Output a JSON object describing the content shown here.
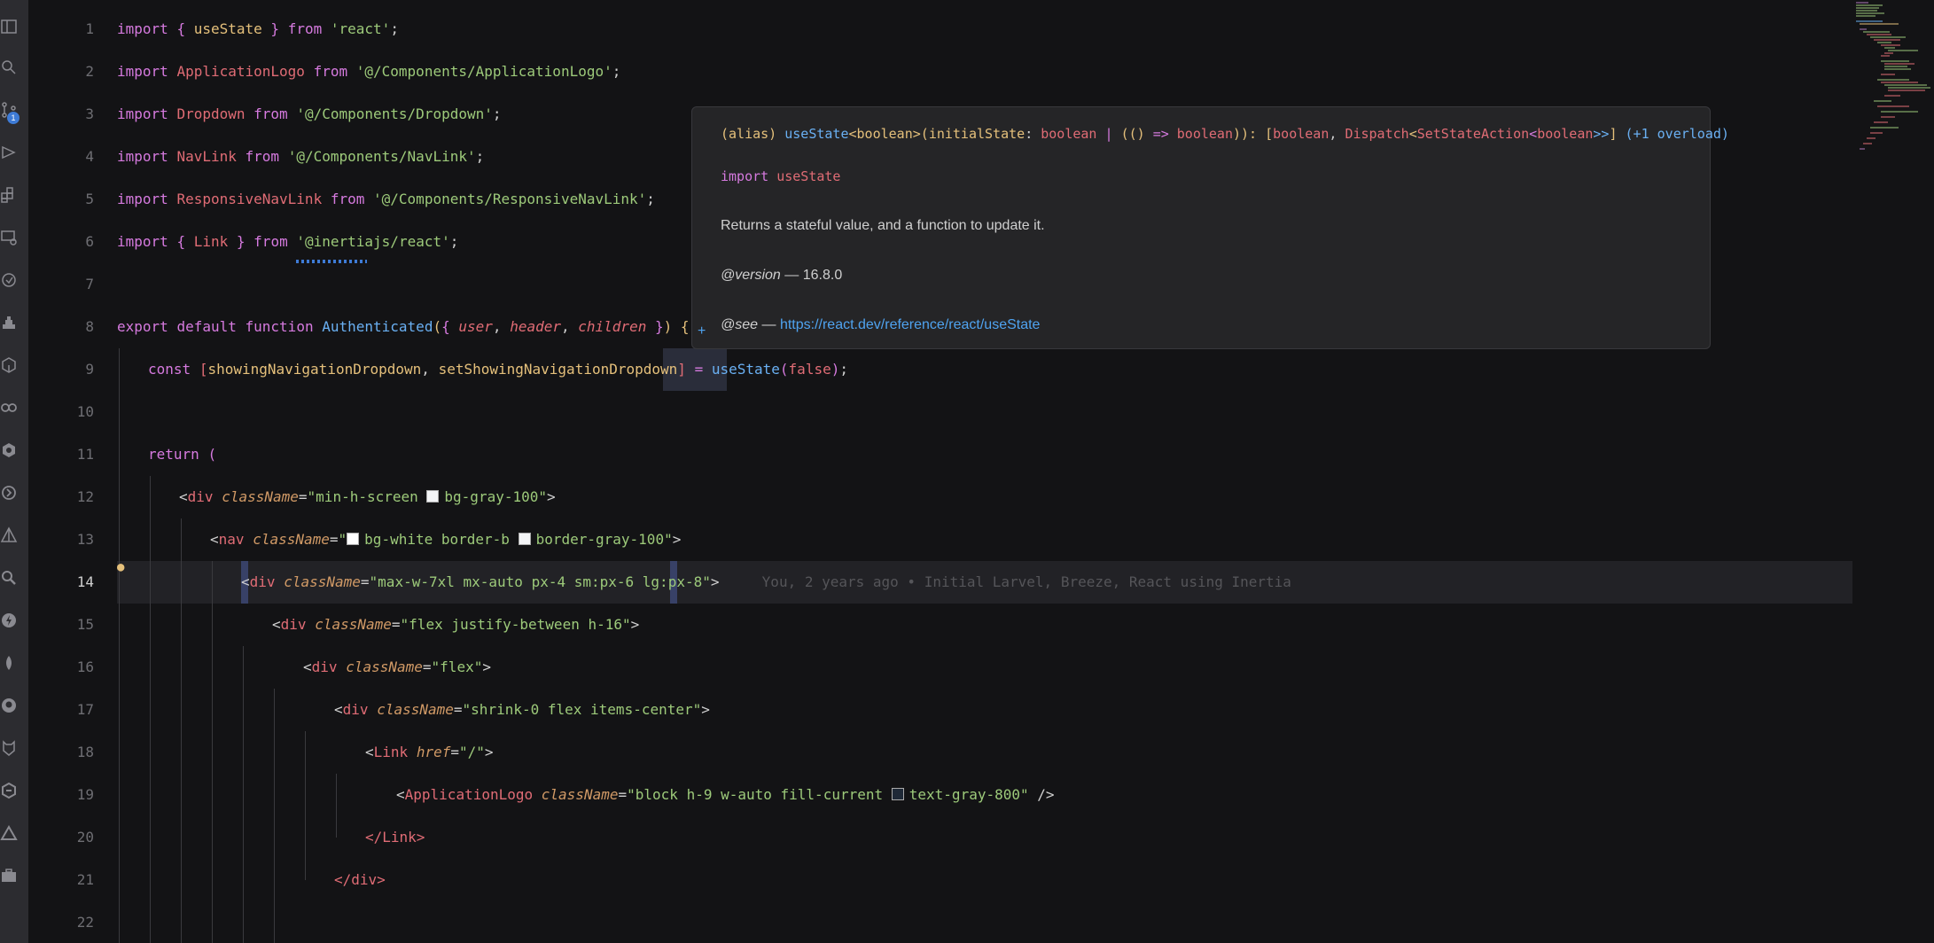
{
  "activity_bar": {
    "badge_count": "1",
    "icons": [
      "sidebar-icon",
      "search-icon",
      "source-control-icon",
      "run-debug-icon",
      "extensions-icon",
      "remote-explorer-icon",
      "docker-icon",
      "testing-icon",
      "database-icon",
      "containers-icon",
      "live-share-icon",
      "settings-sync-icon",
      "git-graph-icon",
      "azure-icon",
      "search-2-icon",
      "thunder-client-icon",
      "mongodb-icon",
      "github-icon",
      "gitlens-icon",
      "gitkraken-icon",
      "deploy-icon",
      "toolbox-icon"
    ]
  },
  "editor": {
    "lines": [
      {
        "n": "1"
      },
      {
        "n": "2"
      },
      {
        "n": "3"
      },
      {
        "n": "4"
      },
      {
        "n": "5"
      },
      {
        "n": "6"
      },
      {
        "n": "7"
      },
      {
        "n": "8"
      },
      {
        "n": "9"
      },
      {
        "n": "10"
      },
      {
        "n": "11"
      },
      {
        "n": "12"
      },
      {
        "n": "13"
      },
      {
        "n": "14"
      },
      {
        "n": "15"
      },
      {
        "n": "16"
      },
      {
        "n": "17"
      },
      {
        "n": "18"
      },
      {
        "n": "19"
      },
      {
        "n": "20"
      },
      {
        "n": "21"
      },
      {
        "n": "22"
      }
    ],
    "tokens": {
      "import": "import",
      "from": "from",
      "lbrace": "{",
      "rbrace": "}",
      "semi": ";",
      "useState": "useState",
      "react": "'react'",
      "ApplicationLogo": "ApplicationLogo",
      "path_app_logo": "'@/Components/ApplicationLogo'",
      "Dropdown": "Dropdown",
      "path_dropdown": "'@/Components/Dropdown'",
      "NavLink": "NavLink",
      "path_navlink": "'@/Components/NavLink'",
      "ResponsiveNavLink": "ResponsiveNavLink",
      "path_resp": "'@/Components/ResponsiveNavLink'",
      "Link": "Link",
      "path_inertia": "'@inertiajs/react'",
      "export": "export",
      "default": "default",
      "function": "function",
      "Authenticated": "Authenticated",
      "lparen": "(",
      "rparen": ")",
      "user": "user",
      "header": "header",
      "children": "children",
      "comma": ",",
      "const": "const",
      "lbracket": "[",
      "rbracket": "]",
      "showingNavigationDropdown": "showingNavigationDropdown",
      "setShowingNavigationDropdown": "setShowingNavigationDropdown",
      "eq": "=",
      "false": "false",
      "return": "return",
      "div": "div",
      "nav": "nav",
      "className": "className",
      "href": "href",
      "lt": "<",
      "gt": ">",
      "close_self": "/>",
      "cls_min_h": "min-h-screen",
      "cls_bg_gray": "bg-gray-100",
      "cls_bg_white": "bg-white border-b",
      "cls_border_gray": "border-gray-100",
      "cls_max_w": "max-w-7xl mx-auto px-4 sm:px-6 lg:px-8",
      "cls_flex_between": "flex justify-between h-16",
      "cls_flex": "flex",
      "cls_shrink": "shrink-0 flex items-center",
      "href_root": "/",
      "cls_block": "block h-9 w-auto fill-current",
      "cls_text_gray": "text-gray-800",
      "close_link": "</Link>",
      "close_div": "</div>",
      "quote": "\""
    },
    "blame": "You, 2 years ago • Initial Larvel, Breeze, React using Inertia",
    "swatches": {
      "white": "#ffffff",
      "gray_100": "#f3f4f6",
      "gray_800": "#1f2937"
    }
  },
  "tooltip": {
    "sig_alias": "(alias)",
    "sig_name": "useState",
    "sig_type_open": "<boolean>",
    "sig_params_open": "(",
    "sig_param": "initialState",
    "sig_colon": ":",
    "sig_boolean": "boolean",
    "sig_pipe": "|",
    "sig_fn_type": "(()",
    "sig_arrow": "=>",
    "sig_boolean2": "boolean",
    "sig_params_close": ")):",
    "sig_return_open": "[",
    "sig_boolean3": "boolean",
    "sig_comma": ",",
    "sig_dispatch": "Dispatch",
    "sig_lt": "<",
    "sig_setstate": "SetStateAction",
    "sig_lt2": "<",
    "sig_boolean4": "boolean",
    "sig_gt": ">>",
    "sig_return_close": "]",
    "sig_overload": "(+1 overload)",
    "import_kw": "import",
    "import_name": "useState",
    "description": "Returns a stateful value, and a function to update it.",
    "version_tag": "@version",
    "version_text": "— 16.8.0",
    "see_tag": "@see",
    "see_dash": "—",
    "see_link": "https://react.dev/reference/react/useState",
    "plus": "+"
  },
  "colors": {
    "background": "#131315",
    "activity_bar": "#2c2c30",
    "accent": "#3e7bd6"
  }
}
